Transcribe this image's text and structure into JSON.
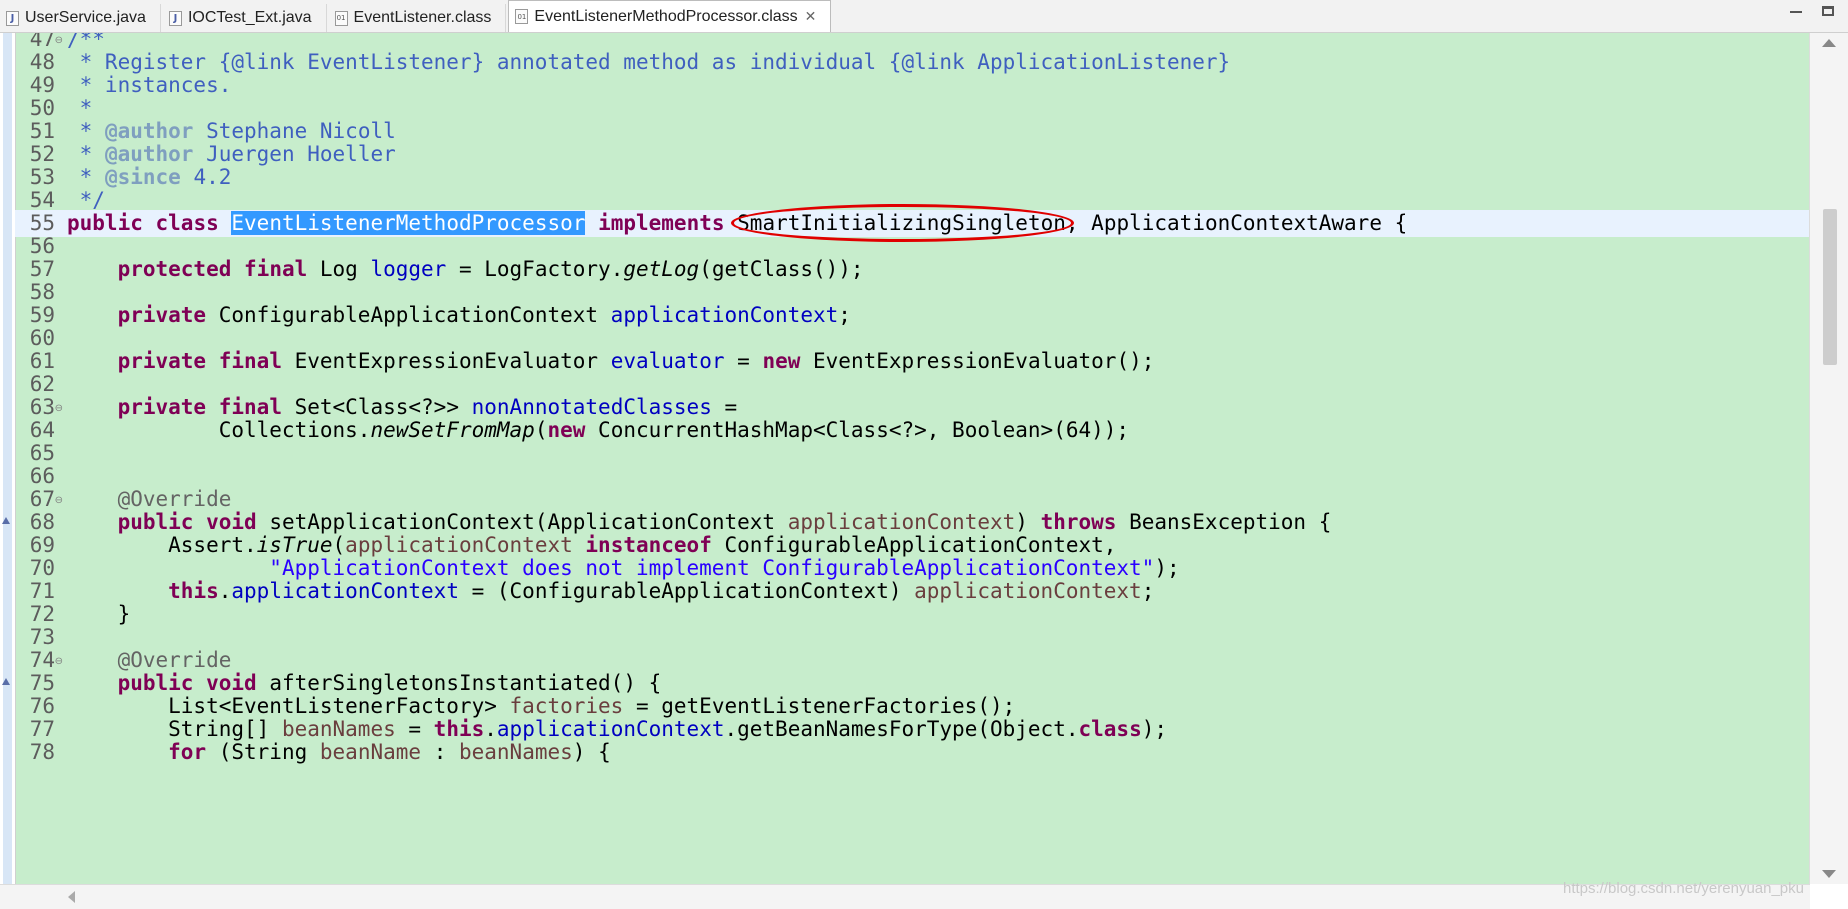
{
  "tabs": [
    {
      "label": "UserService.java",
      "icon": "java-file-icon",
      "active": false
    },
    {
      "label": "IOCTest_Ext.java",
      "icon": "java-file-icon",
      "active": false
    },
    {
      "label": "EventListener.class",
      "icon": "class-file-icon",
      "active": false
    },
    {
      "label": "EventListenerMethodProcessor.class",
      "icon": "class-file-icon",
      "active": true,
      "close": "✕"
    }
  ],
  "colors": {
    "editor_bg": "#c7edcc",
    "keyword": "#7f0055",
    "comment": "#3f5fbf",
    "javadoc_tag": "#7f9fbf",
    "field": "#0000c0",
    "parameter": "#6a3e3e",
    "string": "#2a00ff",
    "selection": "#3399ff",
    "annotation_circle": "#e00000"
  },
  "code": {
    "current_line": 55,
    "lines": [
      {
        "n": "47",
        "fold": "⊖",
        "tokens": [
          [
            "cm",
            "/**"
          ]
        ]
      },
      {
        "n": "48",
        "tokens": [
          [
            "cm",
            " * Register {@link EventListener} annotated method as individual {@link ApplicationListener}"
          ]
        ]
      },
      {
        "n": "49",
        "tokens": [
          [
            "cm",
            " * instances."
          ]
        ]
      },
      {
        "n": "50",
        "tokens": [
          [
            "cm",
            " *"
          ]
        ]
      },
      {
        "n": "51",
        "tokens": [
          [
            "cm",
            " * "
          ],
          [
            "tag",
            "@author"
          ],
          [
            "cm",
            " Stephane Nicoll"
          ]
        ]
      },
      {
        "n": "52",
        "tokens": [
          [
            "cm",
            " * "
          ],
          [
            "tag",
            "@author"
          ],
          [
            "cm",
            " Juergen Hoeller"
          ]
        ]
      },
      {
        "n": "53",
        "tokens": [
          [
            "cm",
            " * "
          ],
          [
            "tag",
            "@since"
          ],
          [
            "cm",
            " 4.2"
          ]
        ]
      },
      {
        "n": "54",
        "tokens": [
          [
            "cm",
            " */"
          ]
        ]
      },
      {
        "n": "55",
        "tokens": [
          [
            "kw",
            "public"
          ],
          [
            "",
            " "
          ],
          [
            "kw",
            "class"
          ],
          [
            "",
            " "
          ],
          [
            "sel",
            "EventListenerMethodProcessor"
          ],
          [
            "",
            " "
          ],
          [
            "kw",
            "implements"
          ],
          [
            "",
            " "
          ],
          [
            "circled",
            "SmartInitializingSingleton"
          ],
          [
            "",
            ", ApplicationContextAware {"
          ]
        ]
      },
      {
        "n": "56",
        "tokens": []
      },
      {
        "n": "57",
        "tokens": [
          [
            "",
            "    "
          ],
          [
            "kw",
            "protected"
          ],
          [
            "",
            " "
          ],
          [
            "kw",
            "final"
          ],
          [
            "",
            " Log "
          ],
          [
            "fld",
            "logger"
          ],
          [
            "",
            " = LogFactory."
          ],
          [
            "it",
            "getLog"
          ],
          [
            "",
            "(getClass());"
          ]
        ]
      },
      {
        "n": "58",
        "tokens": []
      },
      {
        "n": "59",
        "tokens": [
          [
            "",
            "    "
          ],
          [
            "kw",
            "private"
          ],
          [
            "",
            " ConfigurableApplicationContext "
          ],
          [
            "fld",
            "applicationContext"
          ],
          [
            "",
            ";"
          ]
        ]
      },
      {
        "n": "60",
        "tokens": []
      },
      {
        "n": "61",
        "tokens": [
          [
            "",
            "    "
          ],
          [
            "kw",
            "private"
          ],
          [
            "",
            " "
          ],
          [
            "kw",
            "final"
          ],
          [
            "",
            " EventExpressionEvaluator "
          ],
          [
            "fld",
            "evaluator"
          ],
          [
            "",
            " = "
          ],
          [
            "kw",
            "new"
          ],
          [
            "",
            " EventExpressionEvaluator();"
          ]
        ]
      },
      {
        "n": "62",
        "tokens": []
      },
      {
        "n": "63",
        "fold": "⊖",
        "tokens": [
          [
            "",
            "    "
          ],
          [
            "kw",
            "private"
          ],
          [
            "",
            " "
          ],
          [
            "kw",
            "final"
          ],
          [
            "",
            " Set<Class<?>> "
          ],
          [
            "fld",
            "nonAnnotatedClasses"
          ],
          [
            "",
            " ="
          ]
        ]
      },
      {
        "n": "64",
        "tokens": [
          [
            "",
            "            Collections."
          ],
          [
            "it",
            "newSetFromMap"
          ],
          [
            "",
            "("
          ],
          [
            "kw",
            "new"
          ],
          [
            "",
            " ConcurrentHashMap<Class<?>, Boolean>(64));"
          ]
        ]
      },
      {
        "n": "65",
        "tokens": []
      },
      {
        "n": "66",
        "tokens": []
      },
      {
        "n": "67",
        "fold": "⊖",
        "tokens": [
          [
            "",
            "    "
          ],
          [
            "an",
            "@Override"
          ]
        ]
      },
      {
        "n": "68",
        "marker": true,
        "tokens": [
          [
            "",
            "    "
          ],
          [
            "kw",
            "public"
          ],
          [
            "",
            " "
          ],
          [
            "kw",
            "void"
          ],
          [
            "",
            " setApplicationContext(ApplicationContext "
          ],
          [
            "par",
            "applicationContext"
          ],
          [
            "",
            ") "
          ],
          [
            "kw",
            "throws"
          ],
          [
            "",
            " BeansException {"
          ]
        ]
      },
      {
        "n": "69",
        "tokens": [
          [
            "",
            "        Assert."
          ],
          [
            "it",
            "isTrue"
          ],
          [
            "",
            "("
          ],
          [
            "par",
            "applicationContext"
          ],
          [
            "",
            " "
          ],
          [
            "kw",
            "instanceof"
          ],
          [
            "",
            " ConfigurableApplicationContext,"
          ]
        ]
      },
      {
        "n": "70",
        "tokens": [
          [
            "",
            "                "
          ],
          [
            "st",
            "\"ApplicationContext does not implement ConfigurableApplicationContext\""
          ],
          [
            "",
            ");"
          ]
        ]
      },
      {
        "n": "71",
        "tokens": [
          [
            "",
            "        "
          ],
          [
            "kw",
            "this"
          ],
          [
            "",
            "."
          ],
          [
            "fld",
            "applicationContext"
          ],
          [
            "",
            " = (ConfigurableApplicationContext) "
          ],
          [
            "par",
            "applicationContext"
          ],
          [
            "",
            ";"
          ]
        ]
      },
      {
        "n": "72",
        "tokens": [
          [
            "",
            "    }"
          ]
        ]
      },
      {
        "n": "73",
        "tokens": []
      },
      {
        "n": "74",
        "fold": "⊖",
        "tokens": [
          [
            "",
            "    "
          ],
          [
            "an",
            "@Override"
          ]
        ]
      },
      {
        "n": "75",
        "marker": true,
        "tokens": [
          [
            "",
            "    "
          ],
          [
            "kw",
            "public"
          ],
          [
            "",
            " "
          ],
          [
            "kw",
            "void"
          ],
          [
            "",
            " afterSingletonsInstantiated() {"
          ]
        ]
      },
      {
        "n": "76",
        "tokens": [
          [
            "",
            "        List<EventListenerFactory> "
          ],
          [
            "par",
            "factories"
          ],
          [
            "",
            " = getEventListenerFactories();"
          ]
        ]
      },
      {
        "n": "77",
        "tokens": [
          [
            "",
            "        String[] "
          ],
          [
            "par",
            "beanNames"
          ],
          [
            "",
            " = "
          ],
          [
            "kw",
            "this"
          ],
          [
            "",
            "."
          ],
          [
            "fld",
            "applicationContext"
          ],
          [
            "",
            ".getBeanNamesForType(Object."
          ],
          [
            "kw",
            "class"
          ],
          [
            "",
            ");"
          ]
        ]
      },
      {
        "n": "78",
        "tokens": [
          [
            "",
            "        "
          ],
          [
            "kw",
            "for"
          ],
          [
            "",
            " (String "
          ],
          [
            "par",
            "beanName"
          ],
          [
            "",
            " : "
          ],
          [
            "par",
            "beanNames"
          ],
          [
            "",
            ") {"
          ]
        ]
      }
    ]
  },
  "watermark": "https://blog.csdn.net/yerenyuan_pku"
}
